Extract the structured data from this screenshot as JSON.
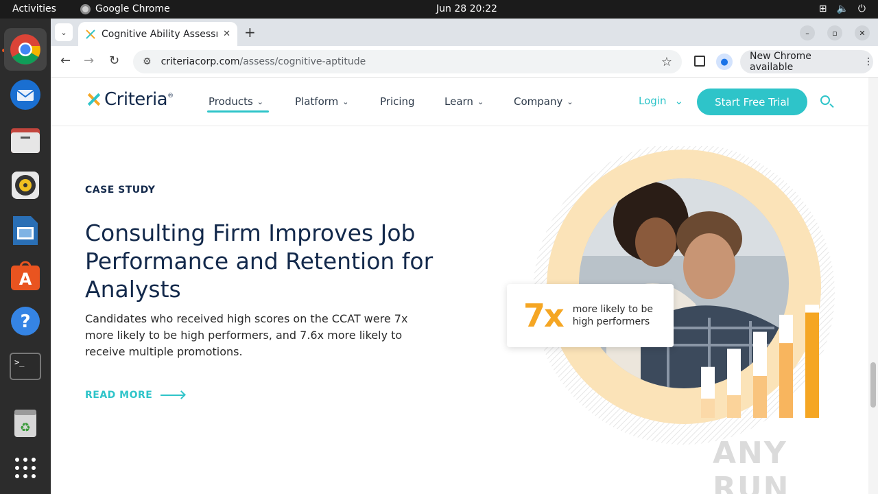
{
  "os": {
    "activities": "Activities",
    "app_name": "Google Chrome",
    "clock": "Jun 28  20:22"
  },
  "browser": {
    "tab_title": "Cognitive Ability Assessm",
    "url_host": "criteriacorp.com",
    "url_path": "/assess/cognitive-aptitude",
    "update_label": "New Chrome available"
  },
  "site": {
    "logo": "Criteria",
    "nav": [
      {
        "label": "Products"
      },
      {
        "label": "Platform"
      },
      {
        "label": "Pricing"
      },
      {
        "label": "Learn"
      },
      {
        "label": "Company"
      }
    ],
    "login": "Login",
    "cta": "Start Free Trial"
  },
  "content": {
    "eyebrow": "CASE STUDY",
    "headline": "Consulting Firm Improves Job Performance and Retention for Analysts",
    "body": "Candidates who received high scores on the CCAT were 7x more likely to be high performers, and 7.6x more likely to receive multiple promotions.",
    "read_more": "READ MORE",
    "stat_value": "7x",
    "stat_caption": "more likely to be high performers"
  },
  "hero_bars": [
    {
      "total": 0.45,
      "fill": 0.17
    },
    {
      "total": 0.61,
      "fill": 0.2
    },
    {
      "total": 0.76,
      "fill": 0.37
    },
    {
      "total": 0.91,
      "fill": 0.66
    },
    {
      "total": 1.0,
      "fill": 0.93
    }
  ],
  "watermark": "ANY RUN",
  "colors": {
    "accent": "#2ec4c9",
    "orange": "#f5a623",
    "navy": "#13294b"
  }
}
